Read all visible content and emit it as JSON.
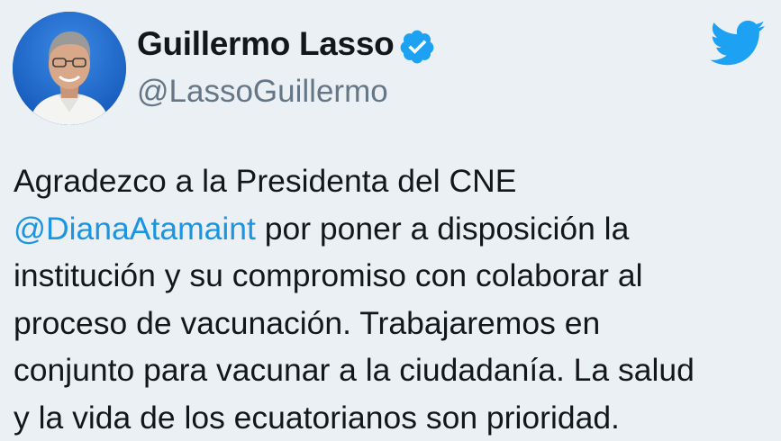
{
  "author": {
    "display_name": "Guillermo Lasso",
    "handle": "@LassoGuillermo",
    "verified": true
  },
  "icons": {
    "verified": "verified-badge-icon",
    "brand": "twitter-bird-icon"
  },
  "tweet": {
    "lines": [
      {
        "text": "Agradezco a la Presidenta del CNE"
      },
      {
        "mention": "@DianaAtamaint",
        "text": " por poner a disposición la"
      },
      {
        "text": "institución y su compromiso con colaborar al"
      },
      {
        "text": "proceso de vacunación. Trabajaremos en"
      },
      {
        "text": "conjunto para vacunar a la ciudadanía. La salud"
      },
      {
        "text": "y la vida de los ecuatorianos son prioridad."
      }
    ]
  },
  "colors": {
    "background": "#ebf0f5",
    "text": "#14171a",
    "secondary_text": "#657786",
    "link": "#1b95e0",
    "verified_badge": "#1da1f2",
    "brand": "#1da1f2"
  }
}
